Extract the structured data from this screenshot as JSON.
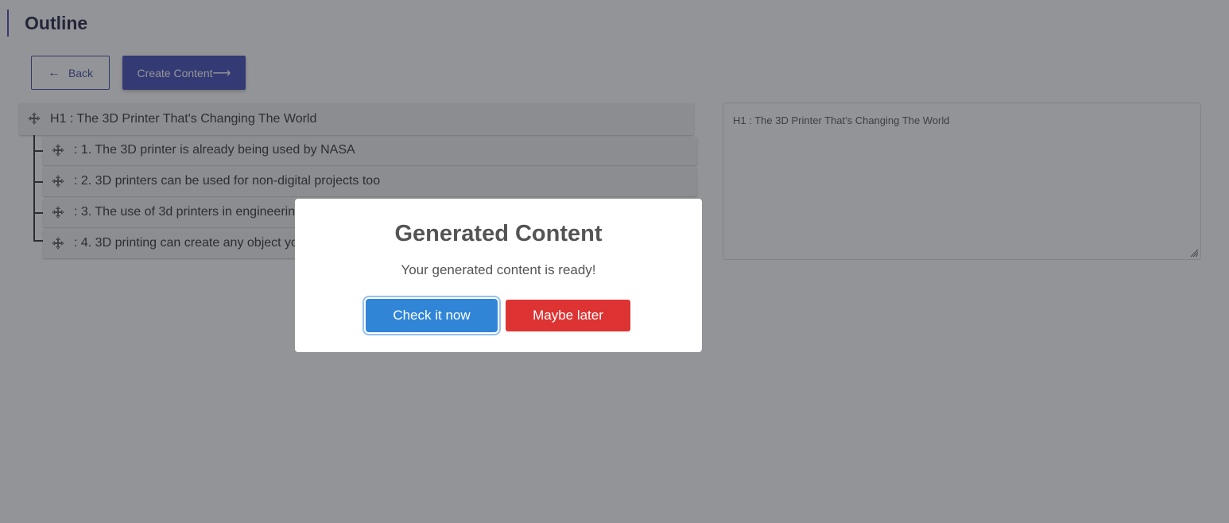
{
  "header": {
    "title": "Outline"
  },
  "actions": {
    "back_arrow": "←",
    "back_label": "Back",
    "create_label": "Create Content",
    "create_arrow": "⟶"
  },
  "outline": {
    "h1": "H1 : The 3D Printer That's Changing The World",
    "children": [
      ": 1. The 3D printer is already being used by NASA",
      ": 2. 3D printers can be used for non-digital projects too",
      ": 3. The use of 3d printers in engineering",
      ": 4. 3D printing can create any object yo"
    ]
  },
  "preview": {
    "text": "H1 : The 3D Printer That's Changing The World"
  },
  "modal": {
    "title": "Generated Content",
    "message": "Your generated content is ready!",
    "confirm_label": "Check it now",
    "cancel_label": "Maybe later"
  },
  "colors": {
    "accent": "#3f4ab8",
    "confirm": "#3085d6",
    "cancel": "#dd3333"
  },
  "icons": {
    "move": "move-icon",
    "back": "arrow-left-icon",
    "create": "arrow-right-icon",
    "resize": "resize-handle-icon"
  }
}
